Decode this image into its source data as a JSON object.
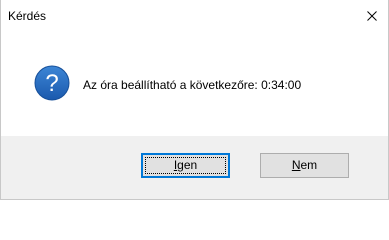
{
  "dialog": {
    "title": "Kérdés",
    "message": "Az óra beállítható a következőre: 0:34:00",
    "icon": "question-icon",
    "close_icon": "close-icon",
    "buttons": {
      "yes": {
        "mnemonic": "I",
        "rest": "gen",
        "is_default": true
      },
      "no": {
        "mnemonic": "N",
        "rest": "em",
        "is_default": false
      }
    }
  },
  "colors": {
    "accent": "#0078d7",
    "icon_fill": "#1f63b8",
    "footer_bg": "#f0f0f0",
    "button_bg": "#e1e1e1"
  }
}
